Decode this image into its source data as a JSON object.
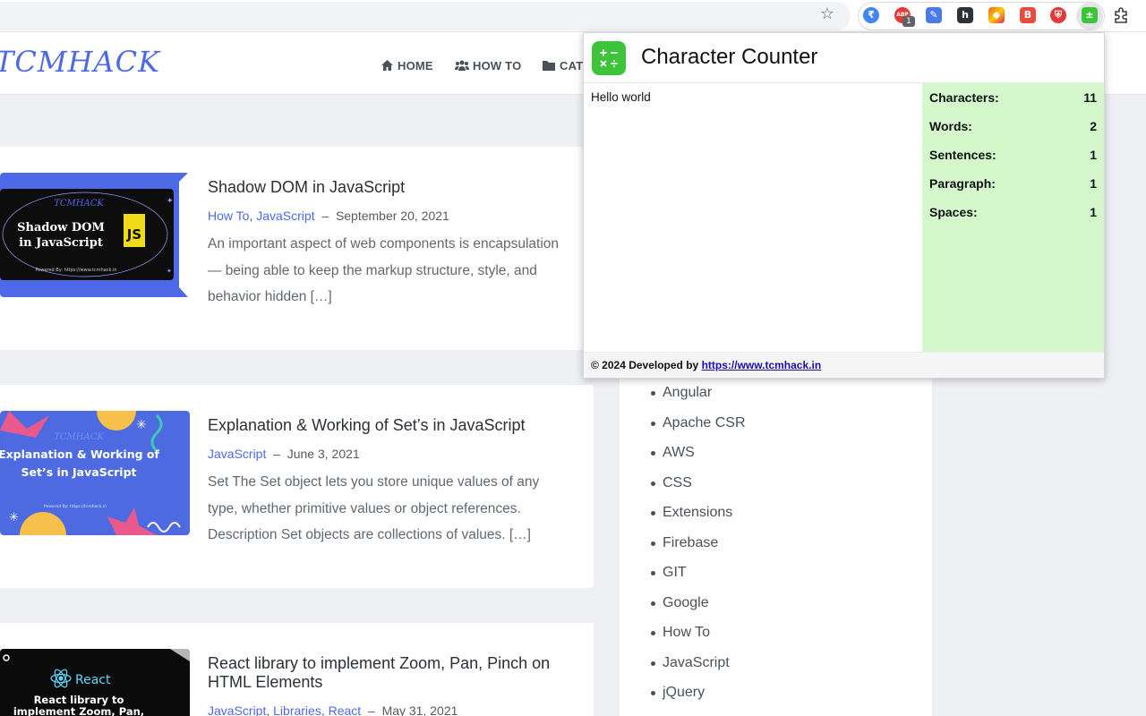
{
  "browser": {
    "star_icon": "bookmark-star-icon",
    "extensions": [
      {
        "name": "rupee-extension",
        "color": "#4285f4",
        "glyph": "₹"
      },
      {
        "name": "adblock-extension",
        "color": "#e53935",
        "glyph": "ABP"
      },
      {
        "name": "translate-extension",
        "color": "#4a7be8",
        "glyph": "✎"
      },
      {
        "name": "h-extension",
        "color": "#2d3338",
        "glyph": "h"
      },
      {
        "name": "colorful-extension",
        "color": "#f15a24",
        "glyph": "◆"
      },
      {
        "name": "b-extension",
        "color": "#e74c3c",
        "glyph": "B"
      },
      {
        "name": "shield-extension",
        "color": "#e53935",
        "glyph": "⛨"
      },
      {
        "name": "character-counter-extension",
        "color": "#3ec43a",
        "glyph": "±"
      }
    ],
    "badge": "1"
  },
  "site": {
    "logo": "TCMHACK",
    "nav": [
      {
        "label": "HOME",
        "icon": "home-icon"
      },
      {
        "label": "HOW TO",
        "icon": "people-icon"
      },
      {
        "label": "CAT",
        "icon": "folder-icon"
      }
    ]
  },
  "posts": [
    {
      "title": "Shadow DOM in JavaScript",
      "categories": [
        "How To",
        "JavaScript"
      ],
      "date": "September 20, 2021",
      "excerpt": "An important aspect of web components is encapsulation — being able to keep the markup structure, style, and behavior hidden […]",
      "thumb": {
        "brand": "TCMHACK",
        "title": "Shadow DOM in JavaScript",
        "badge": "JS",
        "footer": "Powered By: https://www.tcmhack.in"
      }
    },
    {
      "title": "Explanation & Working of Set’s in JavaScript",
      "categories": [
        "JavaScript"
      ],
      "date": "June 3, 2021",
      "excerpt": "Set The Set object lets you store unique values of any type, whether primitive values or object references. Description Set objects are collections of values. […]",
      "thumb": {
        "brand": "TCMHACK",
        "title": "Explanation & Working of Set’s in JavaScript",
        "footer": "Powered By: https://tcmhack.in"
      }
    },
    {
      "title": "React library to implement Zoom, Pan, Pinch on HTML Elements",
      "categories": [
        "JavaScript",
        "Libraries",
        "React"
      ],
      "date": "May 31, 2021",
      "excerpt": "",
      "thumb": {
        "brand": "React",
        "title": "React library to implement Zoom, Pan,"
      }
    }
  ],
  "sidebar": {
    "categories": [
      "Angular",
      "Apache CSR",
      "AWS",
      "CSS",
      "Extensions",
      "Firebase",
      "GIT",
      "Google",
      "How To",
      "JavaScript",
      "jQuery"
    ]
  },
  "popup": {
    "title": "Character Counter",
    "text": "Hello world",
    "stats": [
      {
        "label": "Characters:",
        "value": "11"
      },
      {
        "label": "Words:",
        "value": "2"
      },
      {
        "label": "Sentences:",
        "value": "1"
      },
      {
        "label": "Paragraph:",
        "value": "1"
      },
      {
        "label": "Spaces:",
        "value": "1"
      }
    ],
    "footer_prefix": "© 2024 Developed by",
    "footer_link": "https://www.tcmhack.in",
    "stats_bg": "#d4f8cc",
    "icon_color": "#3ec43a"
  },
  "colors": {
    "accent": "#4d69e8",
    "page_bg": "#eef0f3"
  }
}
